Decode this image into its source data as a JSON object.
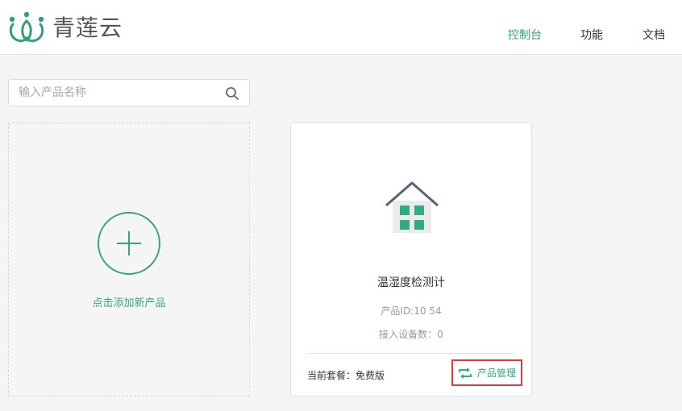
{
  "header": {
    "logo_text": "青莲云",
    "nav": [
      {
        "label": "控制台",
        "active": true
      },
      {
        "label": "功能",
        "active": false
      },
      {
        "label": "文档",
        "active": false
      }
    ]
  },
  "search": {
    "placeholder": "输入产品名称",
    "value": ""
  },
  "add_card": {
    "label": "点击添加新产品"
  },
  "product": {
    "name": "温湿度检测计",
    "id_text": "产品ID:10         54",
    "device_count_text": "接入设备数：0",
    "plan_text": "当前套餐：免费版",
    "manage_label": "产品管理"
  },
  "colors": {
    "brand": "#31a07a",
    "highlight_border": "#e23a3a"
  },
  "icons": {
    "logo": "lotus-logo-icon",
    "search": "search-icon",
    "add": "plus-circle-icon",
    "product": "house-icon",
    "manage": "sync-icon"
  }
}
